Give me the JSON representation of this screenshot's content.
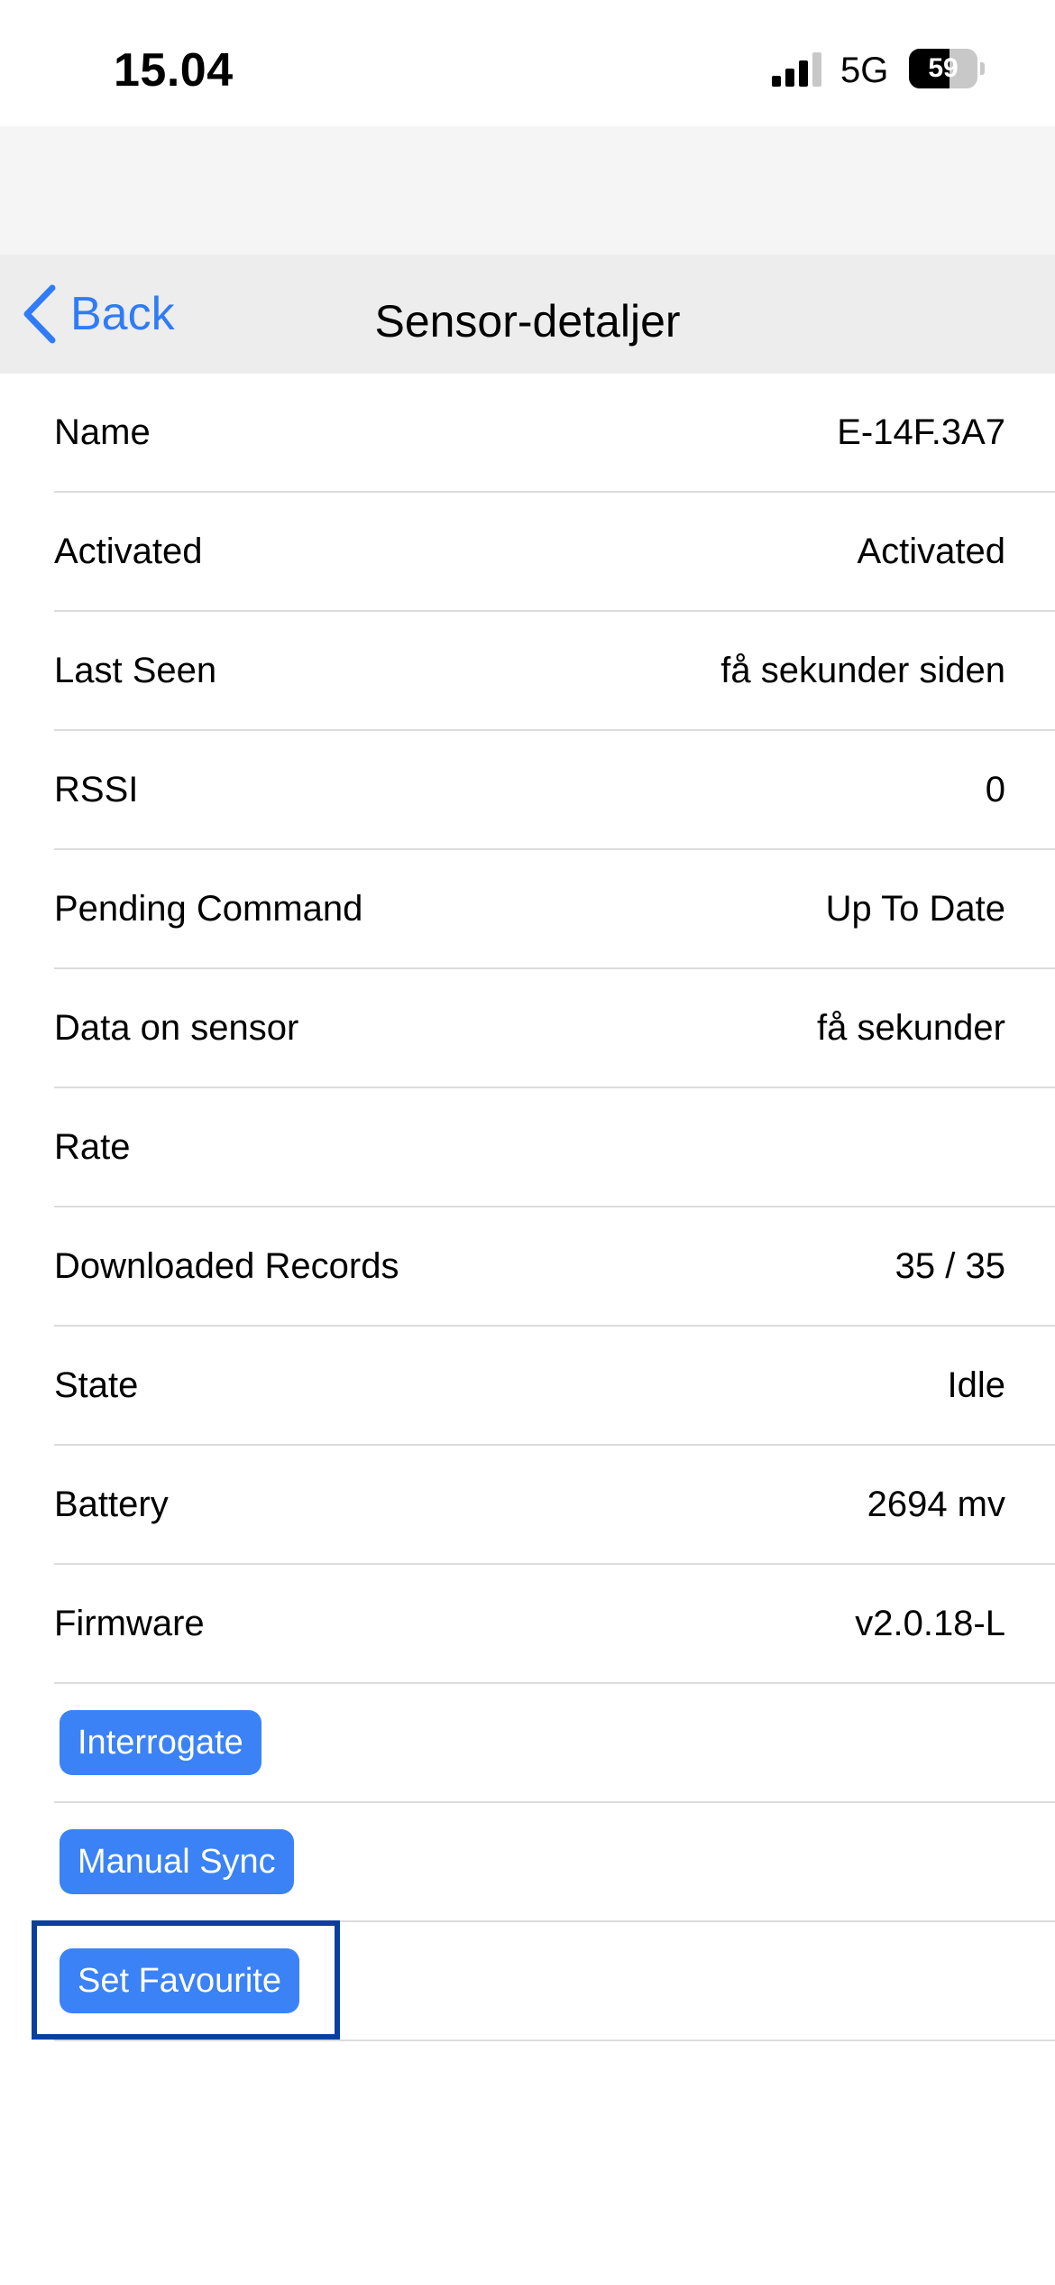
{
  "status_bar": {
    "time": "15.04",
    "network": "5G",
    "battery_percent": "59",
    "battery_level": 0.59,
    "signal_bars": 3,
    "signal_bars_max": 4
  },
  "nav": {
    "back_label": "Back",
    "title": "Sensor-detaljer"
  },
  "rows": [
    {
      "label": "Name",
      "value": "E-14F.3A7"
    },
    {
      "label": "Activated",
      "value": "Activated"
    },
    {
      "label": "Last Seen",
      "value": "få sekunder siden"
    },
    {
      "label": "RSSI",
      "value": "0"
    },
    {
      "label": "Pending Command",
      "value": "Up To Date"
    },
    {
      "label": "Data on sensor",
      "value": "få sekunder"
    },
    {
      "label": "Rate",
      "value": ""
    },
    {
      "label": "Downloaded Records",
      "value": "35 / 35"
    },
    {
      "label": "State",
      "value": "Idle"
    },
    {
      "label": "Battery",
      "value": "2694 mv"
    },
    {
      "label": "Firmware",
      "value": "v2.0.18-L"
    }
  ],
  "actions": {
    "interrogate": "Interrogate",
    "manual_sync": "Manual Sync",
    "set_favourite": "Set Favourite"
  },
  "colors": {
    "accent": "#2f7cf6",
    "button_bg": "#3b82f6",
    "highlight": "#0a3fa0"
  }
}
